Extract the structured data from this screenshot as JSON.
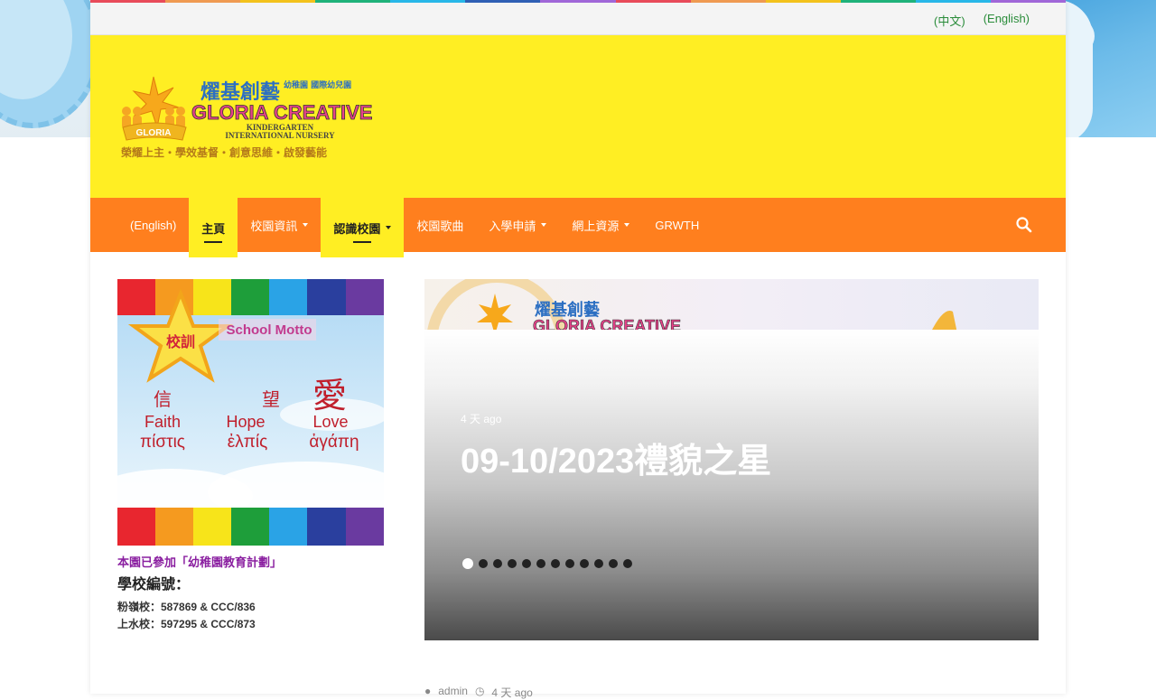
{
  "colors": {
    "header_bg": "#ffee23",
    "nav_bg": "#ff7f1e",
    "link_green": "#2a8c3a",
    "purple": "#8a1fa0",
    "stripe": [
      "#e84b5a",
      "#ef9a52",
      "#f3c21c",
      "#1fb27a",
      "#28b7e8",
      "#2f5fb4",
      "#a067d8",
      "#e84b5a",
      "#ef9a52",
      "#f3c21c",
      "#1fb27a",
      "#28b7e8",
      "#a067d8"
    ]
  },
  "topbar": {
    "links": [
      {
        "label": "(中文)"
      },
      {
        "label": "(English)"
      }
    ]
  },
  "logo": {
    "chinese_name": "燿基創藝",
    "chinese_sub": "幼稚園 國際幼兒園",
    "english_name": "GLORIA CREATIVE",
    "line1": "KINDERGARTEN",
    "line2": "INTERNATIONAL NURSERY",
    "crown_text": "GLORIA",
    "tagline": "榮耀上主・學效基督・創意思維・啟發藝能"
  },
  "nav": {
    "items": [
      {
        "label": "(English)",
        "dropdown": false,
        "active": false
      },
      {
        "label": "主頁",
        "dropdown": false,
        "active": true
      },
      {
        "label": "校園資訊",
        "dropdown": true,
        "active": false
      },
      {
        "label": "認識校園",
        "dropdown": true,
        "active": true
      },
      {
        "label": "校園歌曲",
        "dropdown": false,
        "active": false
      },
      {
        "label": "入學申請",
        "dropdown": true,
        "active": false
      },
      {
        "label": "網上資源",
        "dropdown": true,
        "active": false
      },
      {
        "label": "GRWTH",
        "dropdown": false,
        "active": false
      }
    ],
    "search_icon": "search-icon"
  },
  "motto": {
    "star_label": "校訓",
    "title": "School Motto",
    "items": [
      {
        "zh": "信",
        "en": "Faith",
        "gr": "πίστις"
      },
      {
        "zh": "望",
        "en": "Hope",
        "gr": "ἐλπίς"
      },
      {
        "zh": "愛",
        "en": "Love",
        "gr": "ἀγάπη"
      }
    ]
  },
  "info": {
    "join": "本園已參加「幼稚園教育計劃」",
    "label": "學校編號：",
    "lines": [
      "粉嶺校：587869 & CCC/836",
      "上水校：597295 & CCC/873"
    ]
  },
  "slider": {
    "meta": "4 天 ago",
    "title": "09-10/2023禮貌之星",
    "total_slides": 12,
    "current_slide": 1
  },
  "post_meta": {
    "author": "admin",
    "time": "4 天 ago"
  }
}
